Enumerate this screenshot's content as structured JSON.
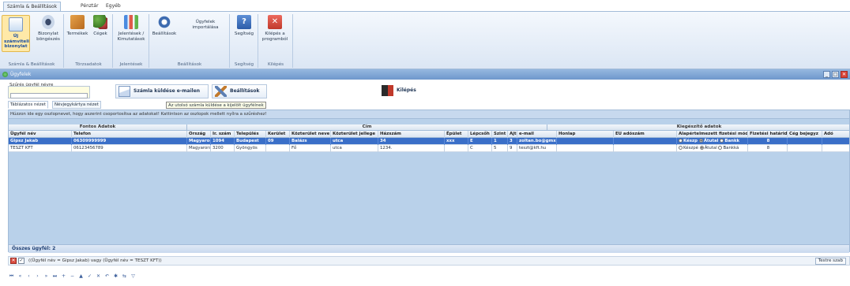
{
  "ribbon_tabs": [
    "Számla & Beállítások",
    "Pénztár",
    "Egyéb"
  ],
  "ribbon": {
    "buttons": [
      {
        "label": "Új számviteli bizonylat",
        "icon": "document-new-icon"
      },
      {
        "label": "Bizonylat böngészés",
        "icon": "eye-icon"
      },
      {
        "label": "Termékek",
        "icon": "products-icon"
      },
      {
        "label": "Cégek",
        "icon": "companies-icon"
      },
      {
        "label": "Jelentések / Kimutatások",
        "icon": "chart-icon"
      },
      {
        "label": "Beállítások",
        "icon": "gear-icon"
      },
      {
        "label": "Ügyfelek importálása",
        "icon": "import-icon"
      },
      {
        "label": "Segítség",
        "icon": "help-icon"
      },
      {
        "label": "Kilépés a programból",
        "icon": "exit-icon"
      }
    ],
    "groups": [
      "Számla & Beállítások",
      "Törzsadatok",
      "Jelentések",
      "Beállítások",
      "Segítség",
      "Kilépés"
    ]
  },
  "window": {
    "title": "Ügyfelek"
  },
  "toolbar": {
    "search_label": "Szűrés ügyfél névre",
    "send_invoice_label": "Számla küldése e-mailen",
    "settings_label": "Beállítások",
    "exit_label": "Kilépés"
  },
  "view_tabs": [
    "Táblázatos nézet",
    "Névjegykártya nézet"
  ],
  "tooltip": "Az utolsó számla küldése a kijelölt ügyfélnek",
  "grid": {
    "group_hint": "Húzzon ide egy oszlopnevet, hogy aszerint csoportosítsa az adatokat! Kattintson az oszlopok mellett nyílra a szűréshez!",
    "bands": [
      "Fontos Adatok",
      "Cím",
      "Kiegészítő adatok"
    ],
    "columns": [
      "Ügyfél név",
      "Telefon",
      "Ország",
      "Ir. szám",
      "Település",
      "Kerület",
      "Közterület neve",
      "Közterület jellege",
      "Házszám",
      "Épület",
      "Lépcsőh",
      "Szint",
      "Ajtó",
      "e-mail",
      "Honlap",
      "EU adószám",
      "Alapértelmezett fizetési mód",
      "Fizetési határidő",
      "Cég bejegyz",
      "Adó"
    ],
    "rows": [
      {
        "name": "Gipsz Jakab",
        "phone": "06309999999",
        "country": "Magyarország",
        "zip": "1094",
        "city": "Budapest",
        "district": "09",
        "street": "Balázs",
        "street_type": "utca",
        "house": "34",
        "building": "xxx",
        "stair": "E",
        "floor": "1",
        "door": "3",
        "email": "zoltan.bo@gmx",
        "web": "",
        "eu": "",
        "pay_opts": [
          "Készp",
          "Átutal",
          "Bankk"
        ],
        "pay_sel": 1,
        "deadline": "8"
      },
      {
        "name": "TESZT KFT",
        "phone": "06123456789",
        "country": "Magyarország",
        "zip": "3200",
        "city": "Gyöngyös",
        "district": "",
        "street": "Fő",
        "street_type": "utca",
        "house": "1234.",
        "building": "",
        "stair": "C",
        "floor": "5",
        "door": "9",
        "email": "teszt@kft.hu",
        "web": "",
        "eu": "",
        "pay_opts": [
          "Készpé",
          "Átutal",
          "Bankká"
        ],
        "pay_sel": 1,
        "deadline": "8"
      }
    ],
    "footer": "Összes ügyfél: 2"
  },
  "filter": {
    "text": "((Ügyfél név = Gipsz Jakab) vagy (Ügyfél név = TESZT KFT))",
    "customize_label": "Testre szab"
  },
  "navigator": [
    "⏮",
    "«",
    "‹",
    "›",
    "»",
    "⏭",
    "+",
    "−",
    "▲",
    "✓",
    "✕",
    "↶",
    "✱",
    "⇆",
    "▽"
  ]
}
